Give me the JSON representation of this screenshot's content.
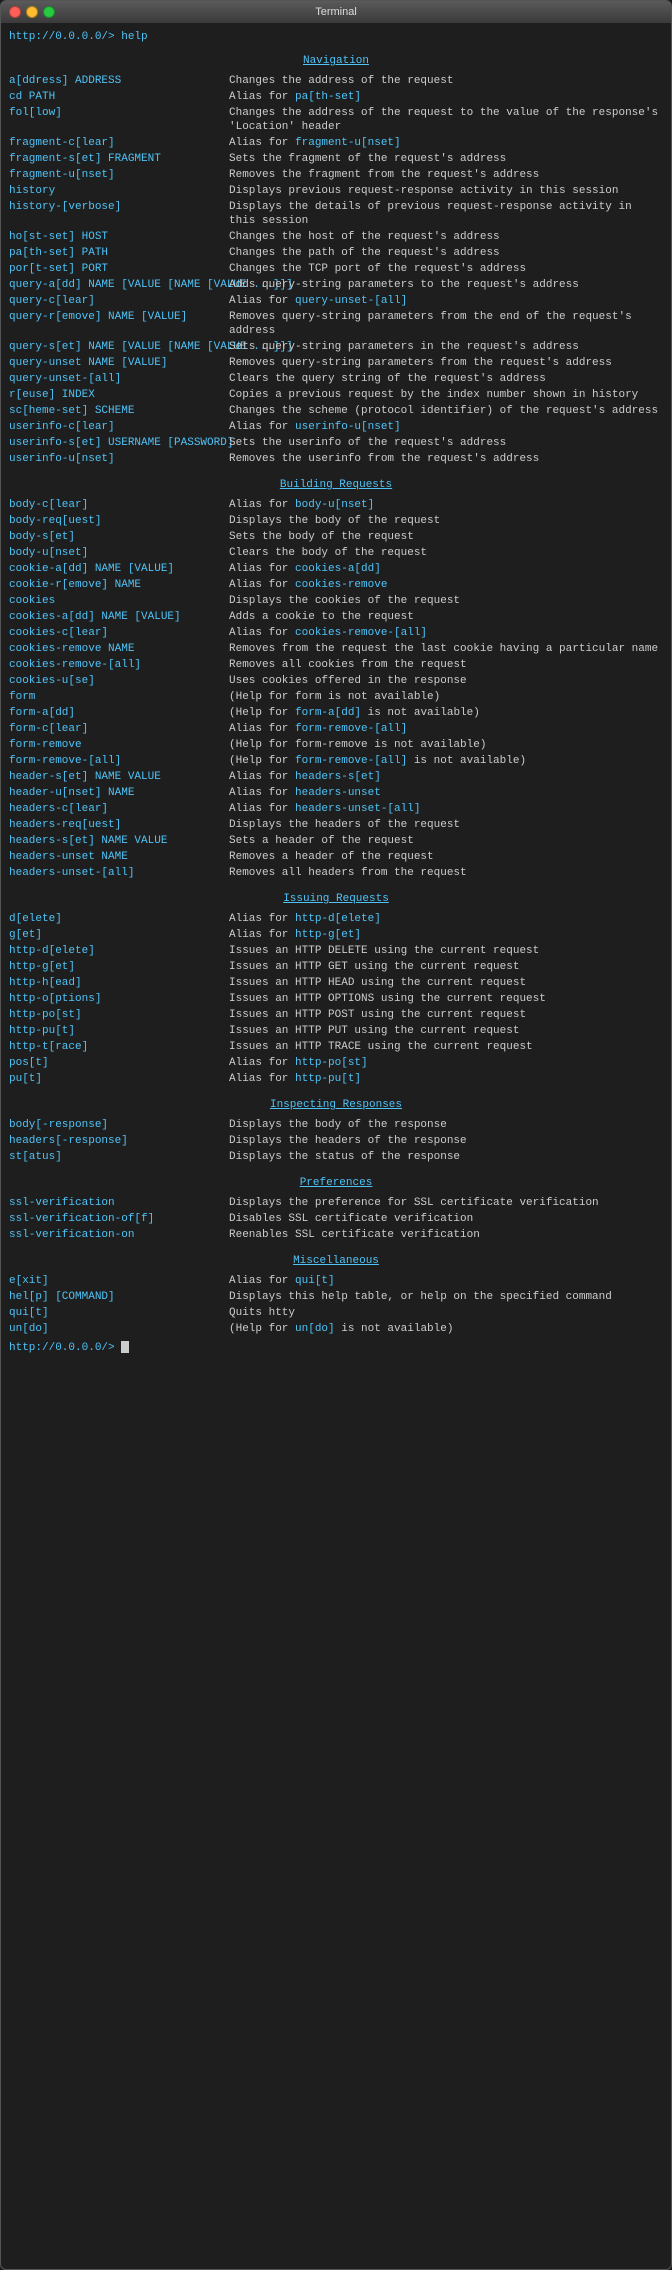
{
  "window": {
    "title": "Terminal"
  },
  "prompt_top": "http://0.0.0.0/> help",
  "prompt_bottom": "http://0.0.0.0/> ",
  "sections": [
    {
      "name": "Navigation",
      "commands": [
        {
          "cmd": "a[ddress] ADDRESS",
          "desc": "Changes the address of the request"
        },
        {
          "cmd": "cd PATH",
          "desc": "Alias for <span class='highlight'>pa[th-set]</span>"
        },
        {
          "cmd": "fol[low]",
          "desc": "Changes the address of the request to the value of the response's 'Location' header"
        },
        {
          "cmd": "fragment-c[lear]",
          "desc": "Alias for <span class='highlight'>fragment-u[nset]</span>"
        },
        {
          "cmd": "fragment-s[et] FRAGMENT",
          "desc": "Sets the fragment of the request's address"
        },
        {
          "cmd": "fragment-u[nset]",
          "desc": "Removes the fragment from the request's address"
        },
        {
          "cmd": "history",
          "desc": "Displays previous request-response activity in this session"
        },
        {
          "cmd": "history-[verbose]",
          "desc": "Displays the details of previous request-response activity in this session"
        },
        {
          "cmd": "ho[st-set] HOST",
          "desc": "Changes the host of the request's address"
        },
        {
          "cmd": "pa[th-set] PATH",
          "desc": "Changes the path of the request's address"
        },
        {
          "cmd": "por[t-set] PORT",
          "desc": "Changes the TCP port of the request's address"
        },
        {
          "cmd": "query-a[dd] NAME [VALUE [NAME [VALUE ...]]]",
          "desc": "Adds query-string parameters to the request's address"
        },
        {
          "cmd": "query-c[lear]",
          "desc": "Alias for <span class='highlight'>query-unset-[all]</span>"
        },
        {
          "cmd": "query-r[emove] NAME [VALUE]",
          "desc": "Removes query-string parameters from the end of the request's address"
        },
        {
          "cmd": "query-s[et] NAME [VALUE [NAME [VALUE ...]]]",
          "desc": "Sets query-string parameters in the request's address"
        },
        {
          "cmd": "query-unset NAME [VALUE]",
          "desc": "Removes query-string parameters from the request's address"
        },
        {
          "cmd": "query-unset-[all]",
          "desc": "Clears the query string of the request's address"
        },
        {
          "cmd": "r[euse] INDEX",
          "desc": "Copies a previous request by the index number shown in history"
        },
        {
          "cmd": "sc[heme-set] SCHEME",
          "desc": "Changes the scheme (protocol identifier) of the request's address"
        },
        {
          "cmd": "userinfo-c[lear]",
          "desc": "Alias for <span class='highlight'>userinfo-u[nset]</span>"
        },
        {
          "cmd": "userinfo-s[et] USERNAME [PASSWORD]",
          "desc": "Sets the userinfo of the request's address"
        },
        {
          "cmd": "userinfo-u[nset]",
          "desc": "Removes the userinfo from the request's address"
        }
      ]
    },
    {
      "name": "Building Requests",
      "commands": [
        {
          "cmd": "body-c[lear]",
          "desc": "Alias for <span class='highlight'>body-u[nset]</span>"
        },
        {
          "cmd": "body-req[uest]",
          "desc": "Displays the body of the request"
        },
        {
          "cmd": "body-s[et]",
          "desc": "Sets the body of the request"
        },
        {
          "cmd": "body-u[nset]",
          "desc": "Clears the body of the request"
        },
        {
          "cmd": "cookie-a[dd] NAME [VALUE]",
          "desc": "Alias for <span class='highlight'>cookies-a[dd]</span>"
        },
        {
          "cmd": "cookie-r[emove] NAME",
          "desc": "Alias for <span class='highlight'>cookies-remove</span>"
        },
        {
          "cmd": "cookies",
          "desc": "Displays the cookies of the request"
        },
        {
          "cmd": "cookies-a[dd] NAME [VALUE]",
          "desc": "Adds a cookie to the request"
        },
        {
          "cmd": "cookies-c[lear]",
          "desc": "Alias for <span class='highlight'>cookies-remove-[all]</span>"
        },
        {
          "cmd": "cookies-remove NAME",
          "desc": "Removes from the request the last cookie having a particular name"
        },
        {
          "cmd": "cookies-remove-[all]",
          "desc": "Removes all cookies from the request"
        },
        {
          "cmd": "cookies-u[se]",
          "desc": "Uses cookies offered in the response"
        },
        {
          "cmd": "form",
          "desc": "(Help for form is not available)"
        },
        {
          "cmd": "form-a[dd]",
          "desc": "(Help for <span class='highlight'>form-a[dd]</span> is not available)"
        },
        {
          "cmd": "form-c[lear]",
          "desc": "Alias for <span class='highlight'>form-remove-[all]</span>"
        },
        {
          "cmd": "form-remove",
          "desc": "(Help for form-remove is not available)"
        },
        {
          "cmd": "form-remove-[all]",
          "desc": "(Help for <span class='highlight'>form-remove-[all]</span> is not available)"
        },
        {
          "cmd": "header-s[et] NAME VALUE",
          "desc": "Alias for <span class='highlight'>headers-s[et]</span>"
        },
        {
          "cmd": "header-u[nset] NAME",
          "desc": "Alias for <span class='highlight'>headers-unset</span>"
        },
        {
          "cmd": "headers-c[lear]",
          "desc": "Alias for <span class='highlight'>headers-unset-[all]</span>"
        },
        {
          "cmd": "headers-req[uest]",
          "desc": "Displays the headers of the request"
        },
        {
          "cmd": "headers-s[et] NAME VALUE",
          "desc": "Sets a header of the request"
        },
        {
          "cmd": "headers-unset NAME",
          "desc": "Removes a header of the request"
        },
        {
          "cmd": "headers-unset-[all]",
          "desc": "Removes all headers from the request"
        }
      ]
    },
    {
      "name": "Issuing Requests",
      "commands": [
        {
          "cmd": "d[elete]",
          "desc": "Alias for <span class='highlight'>http-d[elete]</span>"
        },
        {
          "cmd": "g[et]",
          "desc": "Alias for <span class='highlight'>http-g[et]</span>"
        },
        {
          "cmd": "http-d[elete]",
          "desc": "Issues an HTTP DELETE using the current request"
        },
        {
          "cmd": "http-g[et]",
          "desc": "Issues an HTTP GET using the current request"
        },
        {
          "cmd": "http-h[ead]",
          "desc": "Issues an HTTP HEAD using the current request"
        },
        {
          "cmd": "http-o[ptions]",
          "desc": "Issues an HTTP OPTIONS using the current request"
        },
        {
          "cmd": "http-po[st]",
          "desc": "Issues an HTTP POST using the current request"
        },
        {
          "cmd": "http-pu[t]",
          "desc": "Issues an HTTP PUT using the current request"
        },
        {
          "cmd": "http-t[race]",
          "desc": "Issues an HTTP TRACE using the current request"
        },
        {
          "cmd": "pos[t]",
          "desc": "Alias for <span class='highlight'>http-po[st]</span>"
        },
        {
          "cmd": "pu[t]",
          "desc": "Alias for <span class='highlight'>http-pu[t]</span>"
        }
      ]
    },
    {
      "name": "Inspecting Responses",
      "commands": [
        {
          "cmd": "body[-response]",
          "desc": "Displays the body of the response"
        },
        {
          "cmd": "headers[-response]",
          "desc": "Displays the headers of the response"
        },
        {
          "cmd": "st[atus]",
          "desc": "Displays the status of the response"
        }
      ]
    },
    {
      "name": "Preferences",
      "commands": [
        {
          "cmd": "ssl-verification",
          "desc": "Displays the preference for SSL certificate verification"
        },
        {
          "cmd": "ssl-verification-of[f]",
          "desc": "Disables SSL certificate verification"
        },
        {
          "cmd": "ssl-verification-on",
          "desc": "Reenables SSL certificate verification"
        }
      ]
    },
    {
      "name": "Miscellaneous",
      "commands": [
        {
          "cmd": "e[xit]",
          "desc": "Alias for <span class='highlight'>qui[t]</span>"
        },
        {
          "cmd": "hel[p] [COMMAND]",
          "desc": "Displays this help table, or help on the specified command"
        },
        {
          "cmd": "qui[t]",
          "desc": "Quits htty"
        },
        {
          "cmd": "un[do]",
          "desc": "(Help for <span class='highlight'>un[do]</span> is not available)"
        }
      ]
    }
  ]
}
